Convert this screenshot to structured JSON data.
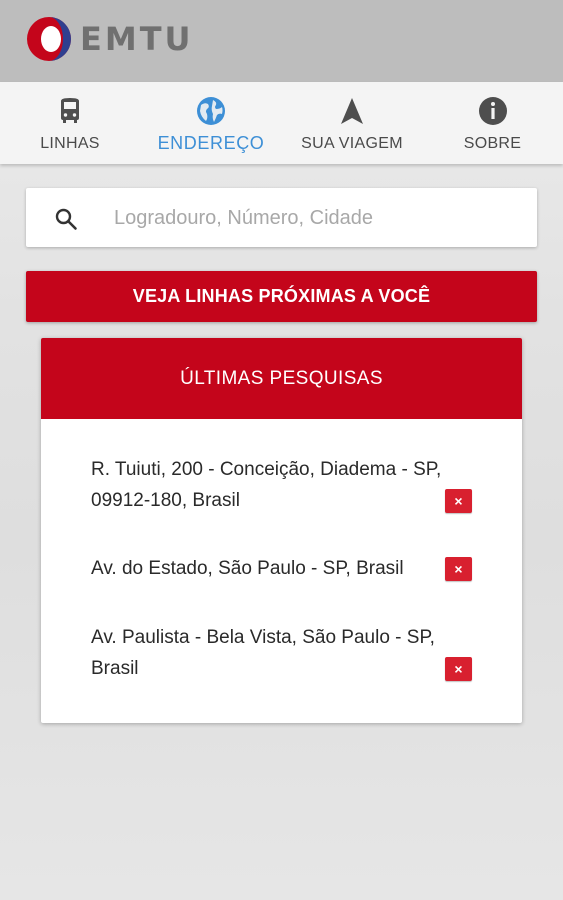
{
  "app": {
    "logo_text": "EMTU"
  },
  "tabs": [
    {
      "label": "LINHAS",
      "icon": "bus-icon"
    },
    {
      "label": "ENDEREÇO",
      "icon": "globe-icon",
      "active": true
    },
    {
      "label": "SUA VIAGEM",
      "icon": "navigation-arrow-icon"
    },
    {
      "label": "SOBRE",
      "icon": "info-icon"
    }
  ],
  "search": {
    "placeholder": "Logradouro, Número, Cidade",
    "value": ""
  },
  "nearby_button": {
    "label": "VEJA LINHAS PRÓXIMAS A VOCÊ"
  },
  "recent": {
    "title": "ÚLTIMAS PESQUISAS",
    "items": [
      {
        "text": "R. Tuiuti, 200 - Conceição, Diadema - SP, 09912-180, Brasil",
        "delete_label": "×"
      },
      {
        "text": "Av. do Estado, São Paulo - SP, Brasil",
        "delete_label": "×"
      },
      {
        "text": "Av. Paulista - Bela Vista, São Paulo - SP, Brasil",
        "delete_label": "×"
      }
    ]
  },
  "colors": {
    "brand_red": "#c4051b",
    "active_tab": "#3d8fd6",
    "app_bar": "#bdbdbd",
    "tab_bar": "#f4f4f4"
  }
}
